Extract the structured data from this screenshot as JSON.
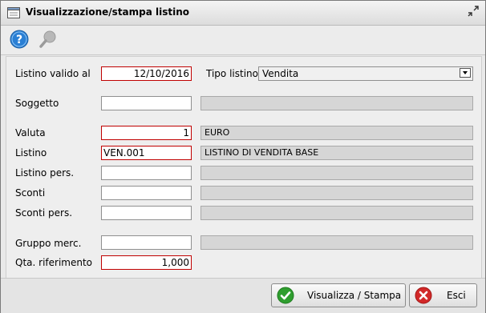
{
  "window": {
    "title": "Visualizzazione/stampa listino"
  },
  "toolbar": {
    "help_icon": "help-icon",
    "search_icon": "search-icon"
  },
  "form": {
    "listino_valido_al": {
      "label": "Listino valido al",
      "value": "12/10/2016"
    },
    "tipo_listino": {
      "label": "Tipo listino",
      "selected": "Vendita"
    },
    "soggetto": {
      "label": "Soggetto",
      "value": "",
      "desc": ""
    },
    "valuta": {
      "label": "Valuta",
      "value": "1",
      "desc": "EURO"
    },
    "listino": {
      "label": "Listino",
      "value": "VEN.001",
      "desc": "LISTINO DI VENDITA BASE"
    },
    "listino_pers": {
      "label": "Listino pers.",
      "value": "",
      "desc": ""
    },
    "sconti": {
      "label": "Sconti",
      "value": "",
      "desc": ""
    },
    "sconti_pers": {
      "label": "Sconti pers.",
      "value": "",
      "desc": ""
    },
    "gruppo_merc": {
      "label": "Gruppo merc.",
      "value": "",
      "desc": ""
    },
    "qta_riferimento": {
      "label": "Qta. riferimento",
      "value": "1,000"
    }
  },
  "footer": {
    "print_label": "Visualizza / Stampa",
    "exit_label": "Esci"
  },
  "colors": {
    "required_border": "#c00000",
    "ok_green": "#2f9e2f",
    "cancel_red": "#d22828",
    "help_blue": "#2a7fd4"
  }
}
